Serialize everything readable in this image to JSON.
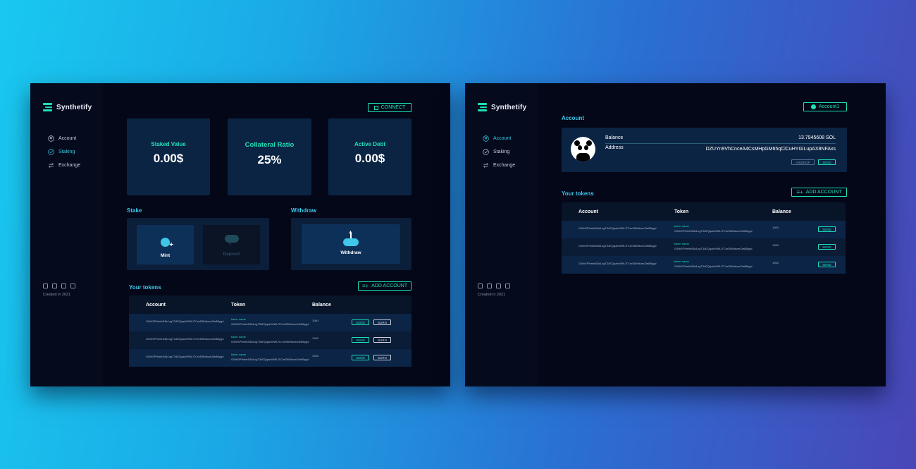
{
  "brand": "Synthetify",
  "nav": [
    "Account",
    "Staking",
    "Exchange"
  ],
  "created": "Created in 2021",
  "staking": {
    "connect": "CONNECT",
    "cards": [
      {
        "label": "Staked Value",
        "value": "0.00$"
      },
      {
        "label": "Collateral Ratio",
        "value": "25%"
      },
      {
        "label": "Active Debt",
        "value": "0.00$"
      }
    ],
    "stake_title": "Stake",
    "withdraw_title": "Withdraw",
    "mint": "Mint",
    "deposit": "Deposit",
    "withdraw": "Withdraw",
    "tokens_title": "Your tokens",
    "add_account": "ADD ACCOUNT",
    "headers": [
      "Account",
      "Token",
      "Balance"
    ],
    "rows": [
      {
        "account": "GWhSPHeiteS6k1ogT34EQqabVfWLITCnrE8MrkzmZte8Bygd",
        "token": "token name",
        "addr": "GWhSPHeiteS6k1ogT34EQqabVfWLITCnrE8MrkzmZte8Bygd",
        "balance": "1000"
      },
      {
        "account": "GWhSPHeiteS6k1ogT34EQqabVfWLITCnrE8MrkzmZte8Bygd",
        "token": "token name",
        "addr": "GWhSPHeiteS6k1ogT34EQqabVfWLITCnrE8MrkzmZte8Bygd",
        "balance": "1000"
      },
      {
        "account": "GWhSPHeiteS6k1ogT34EQqabVfWLITCnrE8MrkzmZte8Bygd",
        "token": "token name",
        "addr": "GWhSPHeiteS6k1ogT34EQqabVfWLITCnrE8MrkzmZte8Bygd",
        "balance": "1000"
      }
    ],
    "send": "SEND",
    "burn": "BURN"
  },
  "account": {
    "account_btn": "Account1",
    "title": "Account",
    "balance_label": "Balance",
    "balance": "13.7945608 SOL",
    "address_label": "Address",
    "address": "DZUYn9VhCnceA4CsMHpGM65qCiCuHYGiLupAX8NFAxs",
    "airdrop": "AIRDROP",
    "send": "SEND",
    "tokens_title": "Your tokens",
    "add_account": "ADD ACCOUNT",
    "headers": [
      "Account",
      "Token",
      "Balance"
    ],
    "rows": [
      {
        "account": "GWhSPHeiteS6k1ogT34EQqabVfWLITCnrE8MrkzmZte8Bygd",
        "token": "token name",
        "addr": "GWhSPHeiteS6k1ogT34EQqabVfWLITCnrE8MrkzmZte8Bygd",
        "balance": "1000"
      },
      {
        "account": "GWhSPHeiteS6k1ogT34EQqabVfWLITCnrE8MrkzmZte8Bygd",
        "token": "token name",
        "addr": "GWhSPHeiteS6k1ogT34EQqabVfWLITCnrE8MrkzmZte8Bygd",
        "balance": "1000"
      },
      {
        "account": "GWhSPHeiteS6k1ogT34EQqabVfWLITCnrE8MrkzmZte8Bygd",
        "token": "token name",
        "addr": "GWhSPHeiteS6k1ogT34EQqabVfWLITCnrE8MrkzmZte8Bygd",
        "balance": "1000"
      }
    ]
  }
}
